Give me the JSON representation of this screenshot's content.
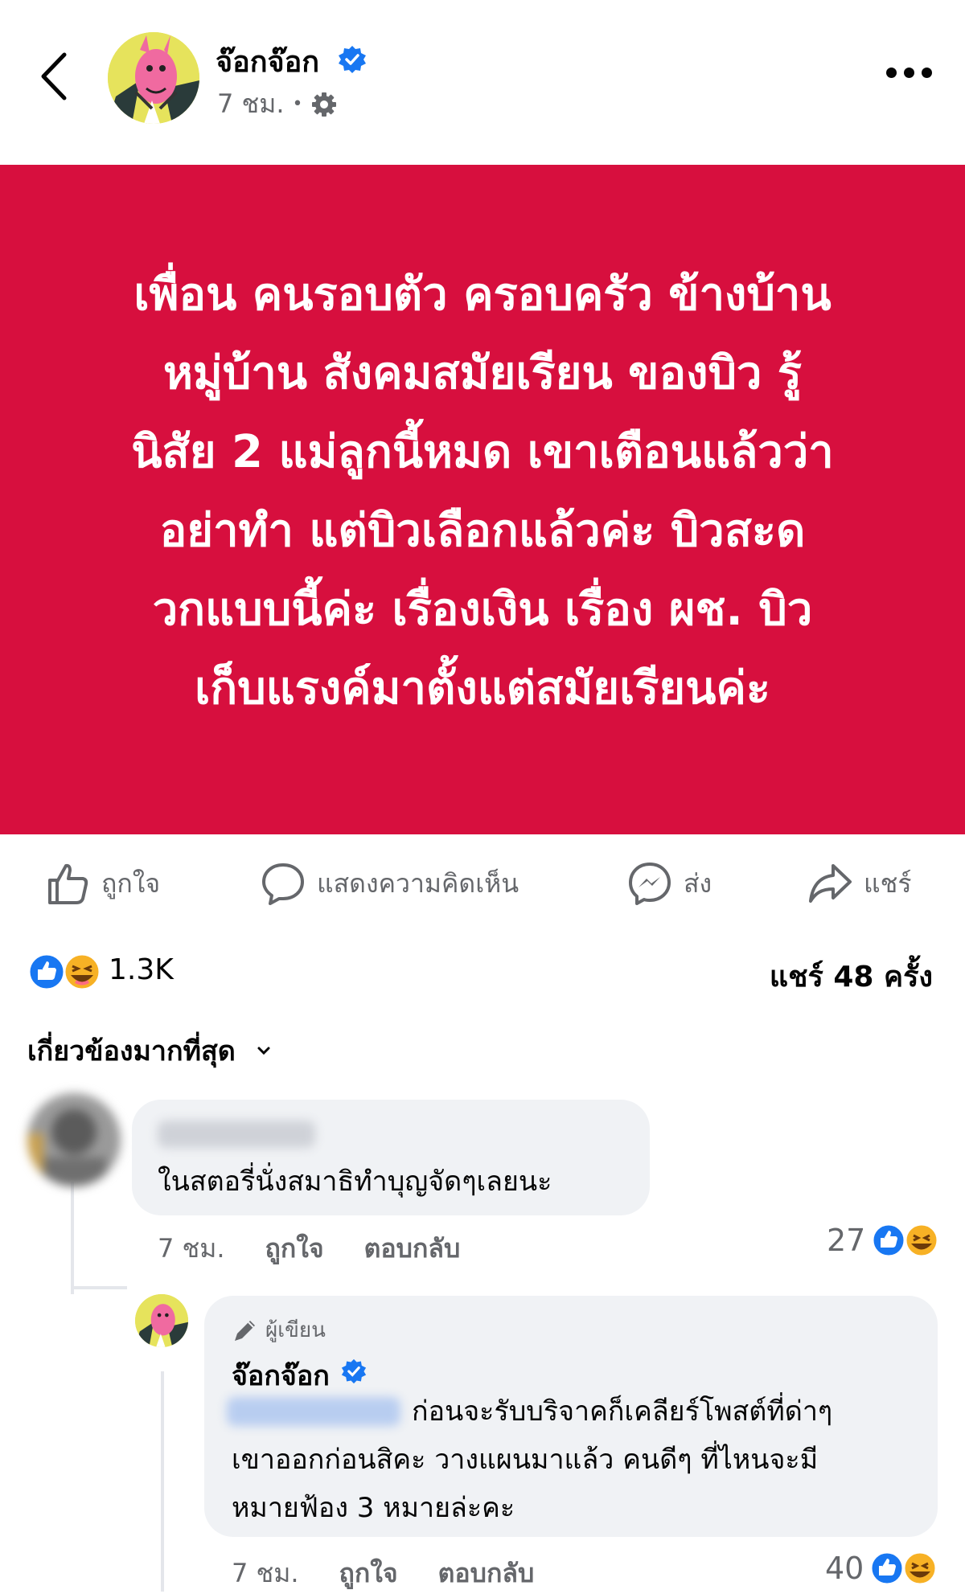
{
  "header": {
    "page_name": "จ๊อกจ๊อก",
    "time": "7 ชม.",
    "separator": "•"
  },
  "post": {
    "text": "เพื่อน คนรอบตัว ครอบครัว ข้างบ้าน หมู่บ้าน สังคมสมัยเรียน ของบิว รู้ นิสัย 2 แม่ลูกนี้หมด เขาเตือนแล้วว่า อย่าทำ แต่บิวเลือกแล้วค่ะ บิวสะด วกแบบนี้ค่ะ เรื่องเงิน เรื่อง ผช. บิว เก็บแรงค์มาตั้งแต่สมัยเรียนค่ะ",
    "lines": [
      "เพื่อน คนรอบตัว ครอบครัว ข้างบ้าน",
      "หมู่บ้าน สังคมสมัยเรียน ของบิว รู้",
      "นิสัย 2 แม่ลูกนี้หมด เขาเตือนแล้วว่า",
      "อย่าทำ แต่บิวเลือกแล้วค่ะ บิวสะด",
      "วกแบบนี้ค่ะ เรื่องเงิน เรื่อง ผช. บิว",
      "เก็บแรงค์มาตั้งแต่สมัยเรียนค่ะ"
    ],
    "background_color": "#d70f3e"
  },
  "actions": {
    "like": "ถูกใจ",
    "comment": "แสดงความคิดเห็น",
    "send": "ส่ง",
    "share": "แชร์"
  },
  "summary": {
    "reaction_count": "1.3K",
    "share_count": "แชร์ 48 ครั้ง",
    "reaction_icons": [
      "like-icon",
      "haha-icon"
    ]
  },
  "filter": {
    "label": "เกี่ยวข้องมากที่สุด"
  },
  "comments": [
    {
      "text": "ในสตอรี่นั่งสมาธิทำบุญจัดๆเลยนะ",
      "time": "7 ชม.",
      "like_label": "ถูกใจ",
      "reply_label": "ตอบกลับ",
      "reaction_count": "27"
    }
  ],
  "reply": {
    "badge": "ผู้เขียน",
    "author": "จ๊อกจ๊อก",
    "lines": [
      "ก่อนจะรับบริจาคก็เคลียร์โพสต์ที่ด่าๆ",
      "เขาออกก่อนสิคะ วางแผนมาแล้ว คนดีๆ ที่ไหนจะมี",
      "หมายฟ้อง 3 หมายล่ะคะ"
    ],
    "time": "7 ชม.",
    "like_label": "ถูกใจ",
    "reply_label": "ตอบกลับ",
    "reaction_count": "40"
  },
  "colors": {
    "accent_blue": "#1877f2",
    "secondary_text": "#65676b",
    "bubble": "#f0f2f5"
  }
}
